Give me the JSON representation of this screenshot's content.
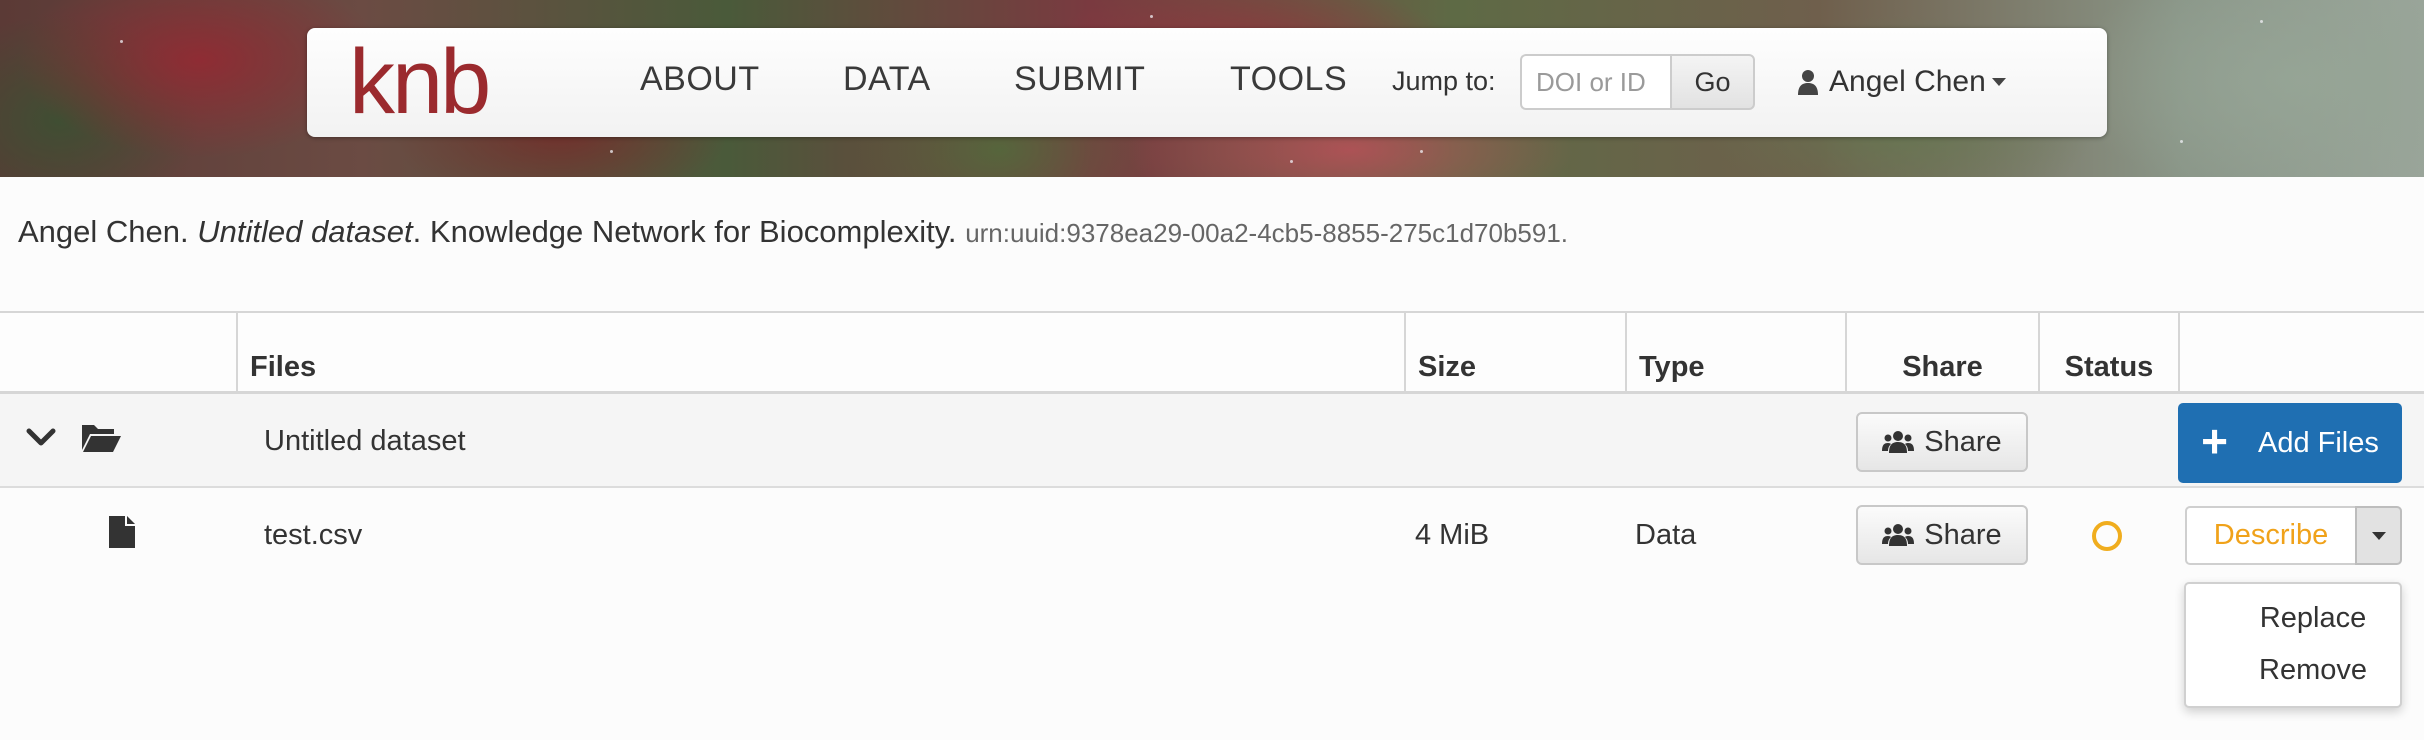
{
  "header": {
    "logo": "knb",
    "nav": [
      "ABOUT",
      "DATA",
      "SUBMIT",
      "TOOLS"
    ],
    "jump_label": "Jump to:",
    "search_placeholder": "DOI or ID",
    "go_label": "Go",
    "user_name": "Angel Chen"
  },
  "citation": {
    "author": "Angel Chen.",
    "title": "Untitled dataset",
    "publisher": ". Knowledge Network for Biocomplexity.",
    "urn": "urn:uuid:9378ea29-00a2-4cb5-8855-275c1d70b591."
  },
  "table": {
    "columns": [
      "Files",
      "Size",
      "Type",
      "Share",
      "Status"
    ],
    "folder_row": {
      "name": "Untitled dataset",
      "share_label": "Share",
      "add_files_label": "Add Files"
    },
    "file_row": {
      "name": "test.csv",
      "size": "4 MiB",
      "type": "Data",
      "share_label": "Share",
      "status_color": "#f0ad1e",
      "describe_label": "Describe"
    }
  },
  "dropdown": {
    "items": [
      "Replace",
      "Remove"
    ]
  },
  "colors": {
    "brand": "#9b2a2e",
    "primary": "#1f6fb2",
    "warning": "#f0a21a"
  }
}
